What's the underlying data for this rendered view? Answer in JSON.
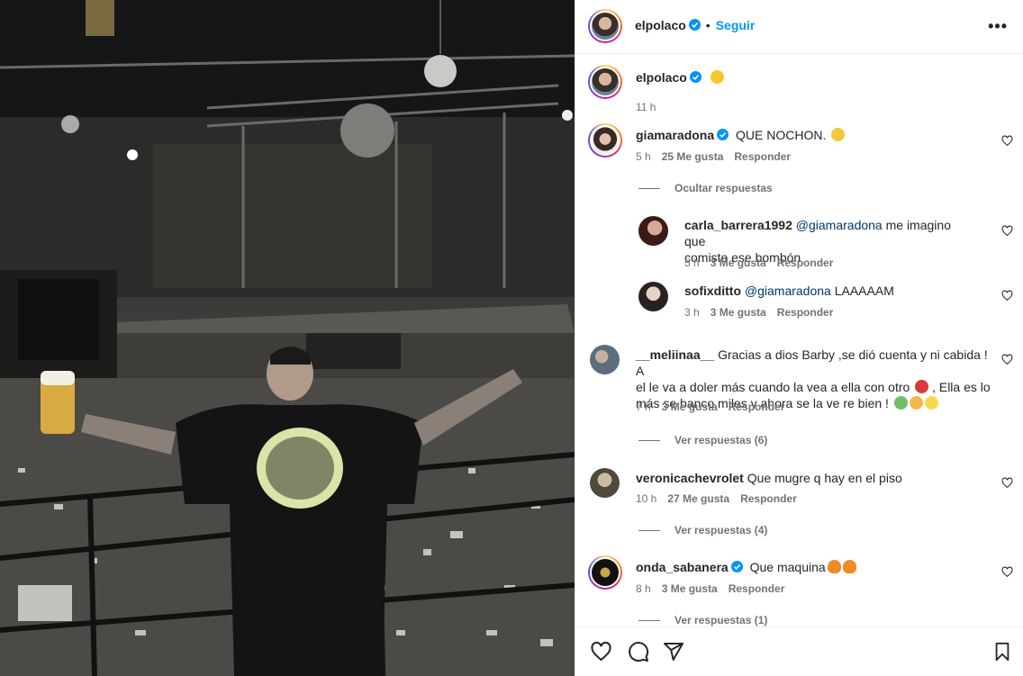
{
  "post": {
    "author": "elpolaco",
    "follow_label": "Seguir",
    "caption_age": "11 h"
  },
  "comments": [
    {
      "user": "giamaradona",
      "text": "QUE NOCHON.",
      "age": "5 h",
      "likes": "25 Me gusta",
      "reply": "Responder",
      "toggle": "Ocultar respuestas"
    },
    {
      "user": "carla_barrera1992",
      "mention": "@giamaradona",
      "text": " me imagino que",
      "text2": "comiste ese bombón",
      "age": "5 h",
      "likes": "3 Me gusta",
      "reply": "Responder"
    },
    {
      "user": "sofixditto",
      "mention": "@giamaradona",
      "text": " LAAAAAM",
      "age": "3 h",
      "likes": "3 Me gusta",
      "reply": "Responder"
    },
    {
      "user": "__meliinaa__",
      "text": "Gracias a dios Barby ,se dió cuenta y ni cabida ! A",
      "text2": "el le va a doler más cuando la vea a ella con otro",
      "text2b": " , Ella es lo",
      "text3": "más se banco miles y ahora se la ve re bien !",
      "age": "7 h",
      "likes": "3 Me gusta",
      "reply": "Responder",
      "toggle": "Ver respuestas (6)"
    },
    {
      "user": "veronicachevrolet",
      "text": "Que mugre q hay en el piso",
      "age": "10 h",
      "likes": "27 Me gusta",
      "reply": "Responder",
      "toggle": "Ver respuestas (4)"
    },
    {
      "user": "onda_sabanera",
      "text": "Que maquina",
      "age": "8 h",
      "likes": "3 Me gusta",
      "reply": "Responder",
      "toggle": "Ver respuestas (1)"
    }
  ],
  "colors": {
    "link": "#0095f6",
    "verified": "#0095f6",
    "muted": "#737373",
    "border": "#efefef"
  }
}
